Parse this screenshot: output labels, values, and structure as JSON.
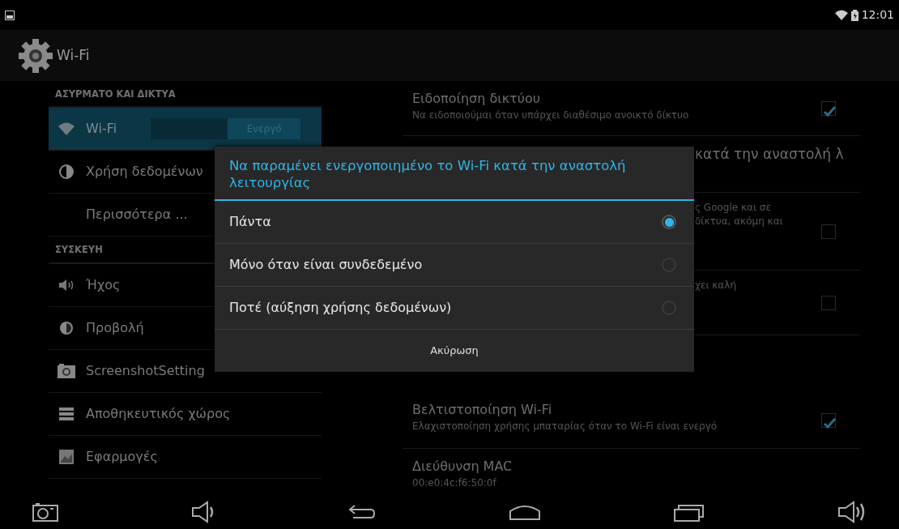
{
  "status_bar": {
    "time": "12:01"
  },
  "action_bar": {
    "title": "Wi-Fi"
  },
  "sidebar": {
    "sections": [
      {
        "header": "ΑΣΥΡΜΑΤΟ ΚΑΙ ΔΙΚΤΥΑ",
        "items": [
          {
            "kind": "wifi",
            "label": "Wi-Fi",
            "selected": true,
            "switch": {
              "label": "Ενεργό",
              "on": true
            }
          },
          {
            "kind": "data",
            "label": "Χρήση δεδομένων",
            "selected": false
          },
          {
            "kind": "none",
            "label": "Περισσότερα ...",
            "selected": false
          }
        ]
      },
      {
        "header": "ΣΥΣΚΕΥΗ",
        "items": [
          {
            "kind": "sound",
            "label": "Ήχος",
            "selected": false
          },
          {
            "kind": "display",
            "label": "Προβολή",
            "selected": false
          },
          {
            "kind": "screenshot",
            "label": "ScreenshotSetting",
            "selected": false
          },
          {
            "kind": "storage",
            "label": "Αποθηκευτικός χώρος",
            "selected": false
          },
          {
            "kind": "apps",
            "label": "Εφαρμογές",
            "selected": false
          }
        ]
      }
    ]
  },
  "preferences": [
    {
      "kind": "full",
      "title": "Ειδοποίηση δικτύου",
      "summary": [
        "Να ειδοποιούμαι όταν υπάρχει διαθέσιμο ανοικτό δίκτυο"
      ],
      "checked": true
    },
    {
      "kind": "partial",
      "title": "κατά την αναστολή λ"
    },
    {
      "kind": "partial",
      "summary": [
        "ς Google και σε",
        "δίκτυα, ακόμη και"
      ],
      "checked": false
    },
    {
      "kind": "partial",
      "summary": [
        "χει καλή"
      ],
      "checked": false
    },
    {
      "kind": "full",
      "title": "Βελτιστοποίηση Wi-Fi",
      "summary": [
        "Ελαχιστοποίηση χρήσης μπαταρίας όταν το Wi-Fi είναι ενεργό"
      ],
      "checked": true
    },
    {
      "kind": "full",
      "title": "Διεύθυνση MAC",
      "summary": [
        "00:e0:4c:f6:50:0f"
      ]
    }
  ],
  "dialog": {
    "title": "Να παραμένει ενεργοποιημένο το Wi-Fi κατά την αναστολή λειτουργίας",
    "options": [
      {
        "label": "Πάντα",
        "selected": true
      },
      {
        "label": "Μόνο όταν είναι συνδεδεμένο",
        "selected": false
      },
      {
        "label": "Ποτέ (αύξηση χρήσης δεδομένων)",
        "selected": false
      }
    ],
    "cancel": "Ακύρωση"
  }
}
